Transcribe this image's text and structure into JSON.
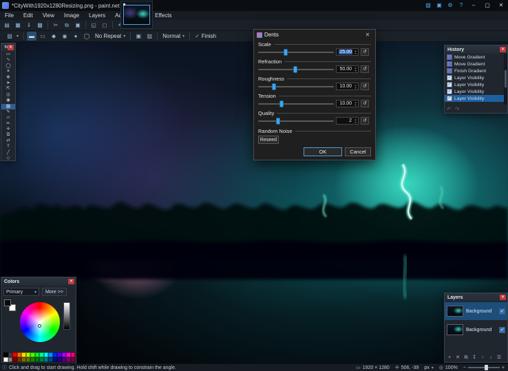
{
  "window": {
    "title": "*CityWith1920x1280Resizing.png - paint.net 4.3.12",
    "utility_icons": [
      {
        "name": "color-picker-icon",
        "glyph": "▨"
      },
      {
        "name": "palette-icon",
        "glyph": "▣"
      },
      {
        "name": "settings-gear-icon",
        "glyph": "⚙"
      },
      {
        "name": "help-icon",
        "glyph": "?"
      }
    ],
    "minimize": "–",
    "maximize": "▢",
    "close": "✕"
  },
  "menu": {
    "items": [
      "File",
      "Edit",
      "View",
      "Image",
      "Layers",
      "Adjustments",
      "Effects"
    ]
  },
  "toolbar": {
    "buttons": [
      {
        "name": "new-file",
        "glyph": "▤"
      },
      {
        "name": "open-file",
        "glyph": "▦"
      },
      {
        "name": "save-file",
        "glyph": "⇓"
      },
      {
        "name": "print",
        "glyph": "▩"
      },
      {
        "name": "cut",
        "glyph": "✂"
      },
      {
        "name": "copy",
        "glyph": "⧉"
      },
      {
        "name": "paste",
        "glyph": "▣"
      },
      {
        "name": "crop-to-selection",
        "glyph": "◱"
      },
      {
        "name": "deselect",
        "glyph": "◻"
      },
      {
        "name": "undo",
        "glyph": "↶"
      },
      {
        "name": "redo",
        "glyph": "↷"
      },
      {
        "name": "history",
        "glyph": "↺"
      }
    ]
  },
  "tool_options": {
    "tool_glyph": "▨",
    "gradient_modes": [
      {
        "name": "linear-gradient",
        "glyph": "▬",
        "selected": true
      },
      {
        "name": "linear-reflected-gradient",
        "glyph": "▭"
      },
      {
        "name": "diamond-gradient",
        "glyph": "◆"
      },
      {
        "name": "radial-gradient",
        "glyph": "◉"
      },
      {
        "name": "conic-gradient",
        "glyph": "●"
      },
      {
        "name": "spiral-gradient",
        "glyph": "◯"
      }
    ],
    "repeat": "No Repeat",
    "channel_icons": [
      {
        "name": "color-channel",
        "glyph": "▣"
      },
      {
        "name": "alpha-channel",
        "glyph": "▨"
      }
    ],
    "blend_label": "Normal",
    "finish_label": "Finish"
  },
  "tools_panel": {
    "title": "Tools",
    "tools": [
      {
        "name": "rectangle-select",
        "glyph": "▭"
      },
      {
        "name": "lasso-select",
        "glyph": "∿"
      },
      {
        "name": "ellipse-select",
        "glyph": "◯"
      },
      {
        "name": "magic-wand",
        "glyph": "✶"
      },
      {
        "name": "pan",
        "glyph": "✥"
      },
      {
        "name": "move-selected-pixels",
        "glyph": "➤"
      },
      {
        "name": "move-selection",
        "glyph": "⇱"
      },
      {
        "name": "zoom",
        "glyph": "◎"
      },
      {
        "name": "paint-bucket",
        "glyph": "◉"
      },
      {
        "name": "gradient",
        "glyph": "▨",
        "selected": true
      },
      {
        "name": "paintbrush",
        "glyph": "✎"
      },
      {
        "name": "eraser",
        "glyph": "▱"
      },
      {
        "name": "pencil",
        "glyph": "✏"
      },
      {
        "name": "color-picker",
        "glyph": "✛"
      },
      {
        "name": "clone-stamp",
        "glyph": "⧉"
      },
      {
        "name": "recolor",
        "glyph": "⇄"
      },
      {
        "name": "text",
        "glyph": "T"
      },
      {
        "name": "line-curve",
        "glyph": "╱"
      },
      {
        "name": "shapes",
        "glyph": "◇"
      }
    ]
  },
  "dialog": {
    "title": "Dents",
    "sliders": [
      {
        "label": "Scale",
        "value": "25.00",
        "pos": 36,
        "selected": true
      },
      {
        "label": "Refraction",
        "value": "50.00",
        "pos": 49
      },
      {
        "label": "Roughness",
        "value": "10.00",
        "pos": 21
      },
      {
        "label": "Tension",
        "value": "10.00",
        "pos": 31
      },
      {
        "label": "Quality",
        "value": "2",
        "pos": 26
      }
    ],
    "random_noise_label": "Random Noise",
    "reseed_label": "Reseed",
    "ok_label": "OK",
    "cancel_label": "Cancel",
    "reset_glyph": "↺"
  },
  "history": {
    "title": "History",
    "items": [
      {
        "label": "Move Gradient",
        "icon": "gradient-icon"
      },
      {
        "label": "Move Gradient",
        "icon": "gradient-icon"
      },
      {
        "label": "Finish Gradient",
        "icon": "gradient-icon"
      },
      {
        "label": "Layer Visibility",
        "icon": "visibility-icon"
      },
      {
        "label": "Layer Visibility",
        "icon": "visibility-icon"
      },
      {
        "label": "Layer Visibility",
        "icon": "visibility-icon"
      },
      {
        "label": "Layer Visibility",
        "icon": "visibility-icon",
        "selected": true
      }
    ],
    "undo_glyph": "↶",
    "redo_glyph": "↷"
  },
  "layers": {
    "title": "Layers",
    "items": [
      {
        "name": "Background",
        "visible": true,
        "selected": true
      },
      {
        "name": "Background",
        "visible": true,
        "selected": false
      }
    ],
    "buttons": [
      {
        "name": "add-layer",
        "glyph": "+"
      },
      {
        "name": "delete-layer",
        "glyph": "✕"
      },
      {
        "name": "duplicate-layer",
        "glyph": "⧉"
      },
      {
        "name": "merge-layer-down",
        "glyph": "↧"
      },
      {
        "name": "move-layer-up",
        "glyph": "↑"
      },
      {
        "name": "move-layer-down",
        "glyph": "↓"
      },
      {
        "name": "layer-properties",
        "glyph": "☰"
      }
    ],
    "check_glyph": "✓"
  },
  "colors": {
    "title": "Colors",
    "mode": "Primary",
    "more_label": "More >>",
    "palette": [
      [
        "#000000",
        "#404040",
        "#FF0000",
        "#FF6A00",
        "#FFD800",
        "#B6FF00",
        "#4CFF00",
        "#00FF21",
        "#00FF90",
        "#00FFFF",
        "#0094FF",
        "#0026FF",
        "#4800FF",
        "#B200FF",
        "#FF00DC",
        "#FF006E"
      ],
      [
        "#FFFFFF",
        "#808080",
        "#7F0000",
        "#7F3300",
        "#7F6A00",
        "#5B7F00",
        "#267F00",
        "#007F0E",
        "#007F46",
        "#007F7F",
        "#004A7F",
        "#00137F",
        "#21007F",
        "#57007F",
        "#7F006E",
        "#7F0037"
      ]
    ]
  },
  "status_bar": {
    "message": "Click and drag to start drawing. Hold shift while drawing to constrain the angle.",
    "image_size": "1920 × 1280",
    "cursor_pos": "506, -39",
    "unit": "px",
    "zoom": "100%"
  },
  "icons": {
    "caret": "▾",
    "check": "✓",
    "info": "ⓘ",
    "size": "▭",
    "crosshair": "✛",
    "magnifier": "◎",
    "minus": "−",
    "plus": "+",
    "close": "✕"
  },
  "accent_colors": {
    "selection_blue": "#1f5fa0",
    "slider_blue": "#42a5e8",
    "close_red": "#c23b3b"
  }
}
